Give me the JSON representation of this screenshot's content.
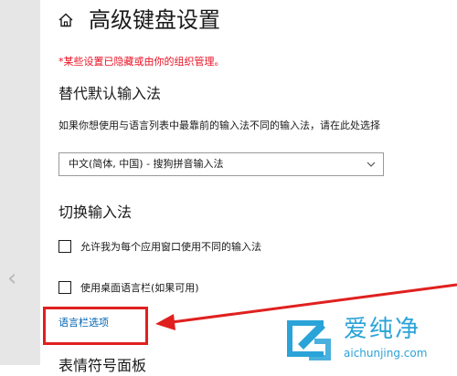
{
  "header": {
    "home_icon": "home-icon",
    "title": "高级键盘设置"
  },
  "managed_note": "*某些设置已隐藏或由你的组织管理。",
  "override_section": {
    "heading": "替代默认输入法",
    "description": "如果你想使用与语言列表中最靠前的输入法不同的输入法，请在此处选择",
    "selected_method": "中文(简体, 中国) - 搜狗拼音输入法"
  },
  "switch_section": {
    "heading": "切换输入法",
    "options": [
      {
        "label": "允许我为每个应用窗口使用不同的输入法",
        "checked": false
      },
      {
        "label": "使用桌面语言栏(如果可用)",
        "checked": false
      }
    ],
    "language_bar_link": "语言栏选项"
  },
  "next_heading": "表情符号面板",
  "watermark": {
    "brand": "爱纯净",
    "url": "aichunjing.com"
  },
  "colors": {
    "accent_link": "#0063b1",
    "warning_text": "#e81123",
    "annotation": "#e0201e",
    "watermark": "#2aa3d8"
  }
}
